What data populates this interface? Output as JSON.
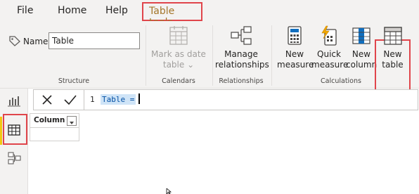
{
  "menubar": {
    "file": "File",
    "home": "Home",
    "help": "Help",
    "active_tab": "Table tools"
  },
  "structure": {
    "name_label": "Name",
    "name_value": "Table",
    "group_label": "Structure"
  },
  "calendars": {
    "mark_line1": "Mark as date",
    "mark_line2": "table ⌄",
    "group_label": "Calendars"
  },
  "relationships": {
    "manage_line1": "Manage",
    "manage_line2": "relationships",
    "group_label": "Relationships"
  },
  "calculations": {
    "new_measure_line1": "New",
    "new_measure_line2": "measure",
    "quick_measure_line1": "Quick",
    "quick_measure_line2": "measure",
    "new_column_line1": "New",
    "new_column_line2": "column",
    "new_table_line1": "New",
    "new_table_line2": "table",
    "group_label": "Calculations"
  },
  "formula": {
    "line_number": "1",
    "text": "Table = "
  },
  "table": {
    "column_header": "Column"
  },
  "icons": {
    "tag": "tag-icon",
    "calendar": "calendar-icon",
    "relationships": "relationships-icon",
    "calculator": "calculator-icon",
    "lightning": "lightning-calculator-icon",
    "column": "column-icon",
    "table": "table-icon",
    "report": "report-view-icon",
    "data": "data-view-icon",
    "model": "model-view-icon",
    "cancel": "close-icon",
    "commit": "check-icon"
  },
  "colors": {
    "highlight": "#e0454b",
    "active_tab_text": "#a4762a",
    "accent_yellow": "#f2c811"
  }
}
